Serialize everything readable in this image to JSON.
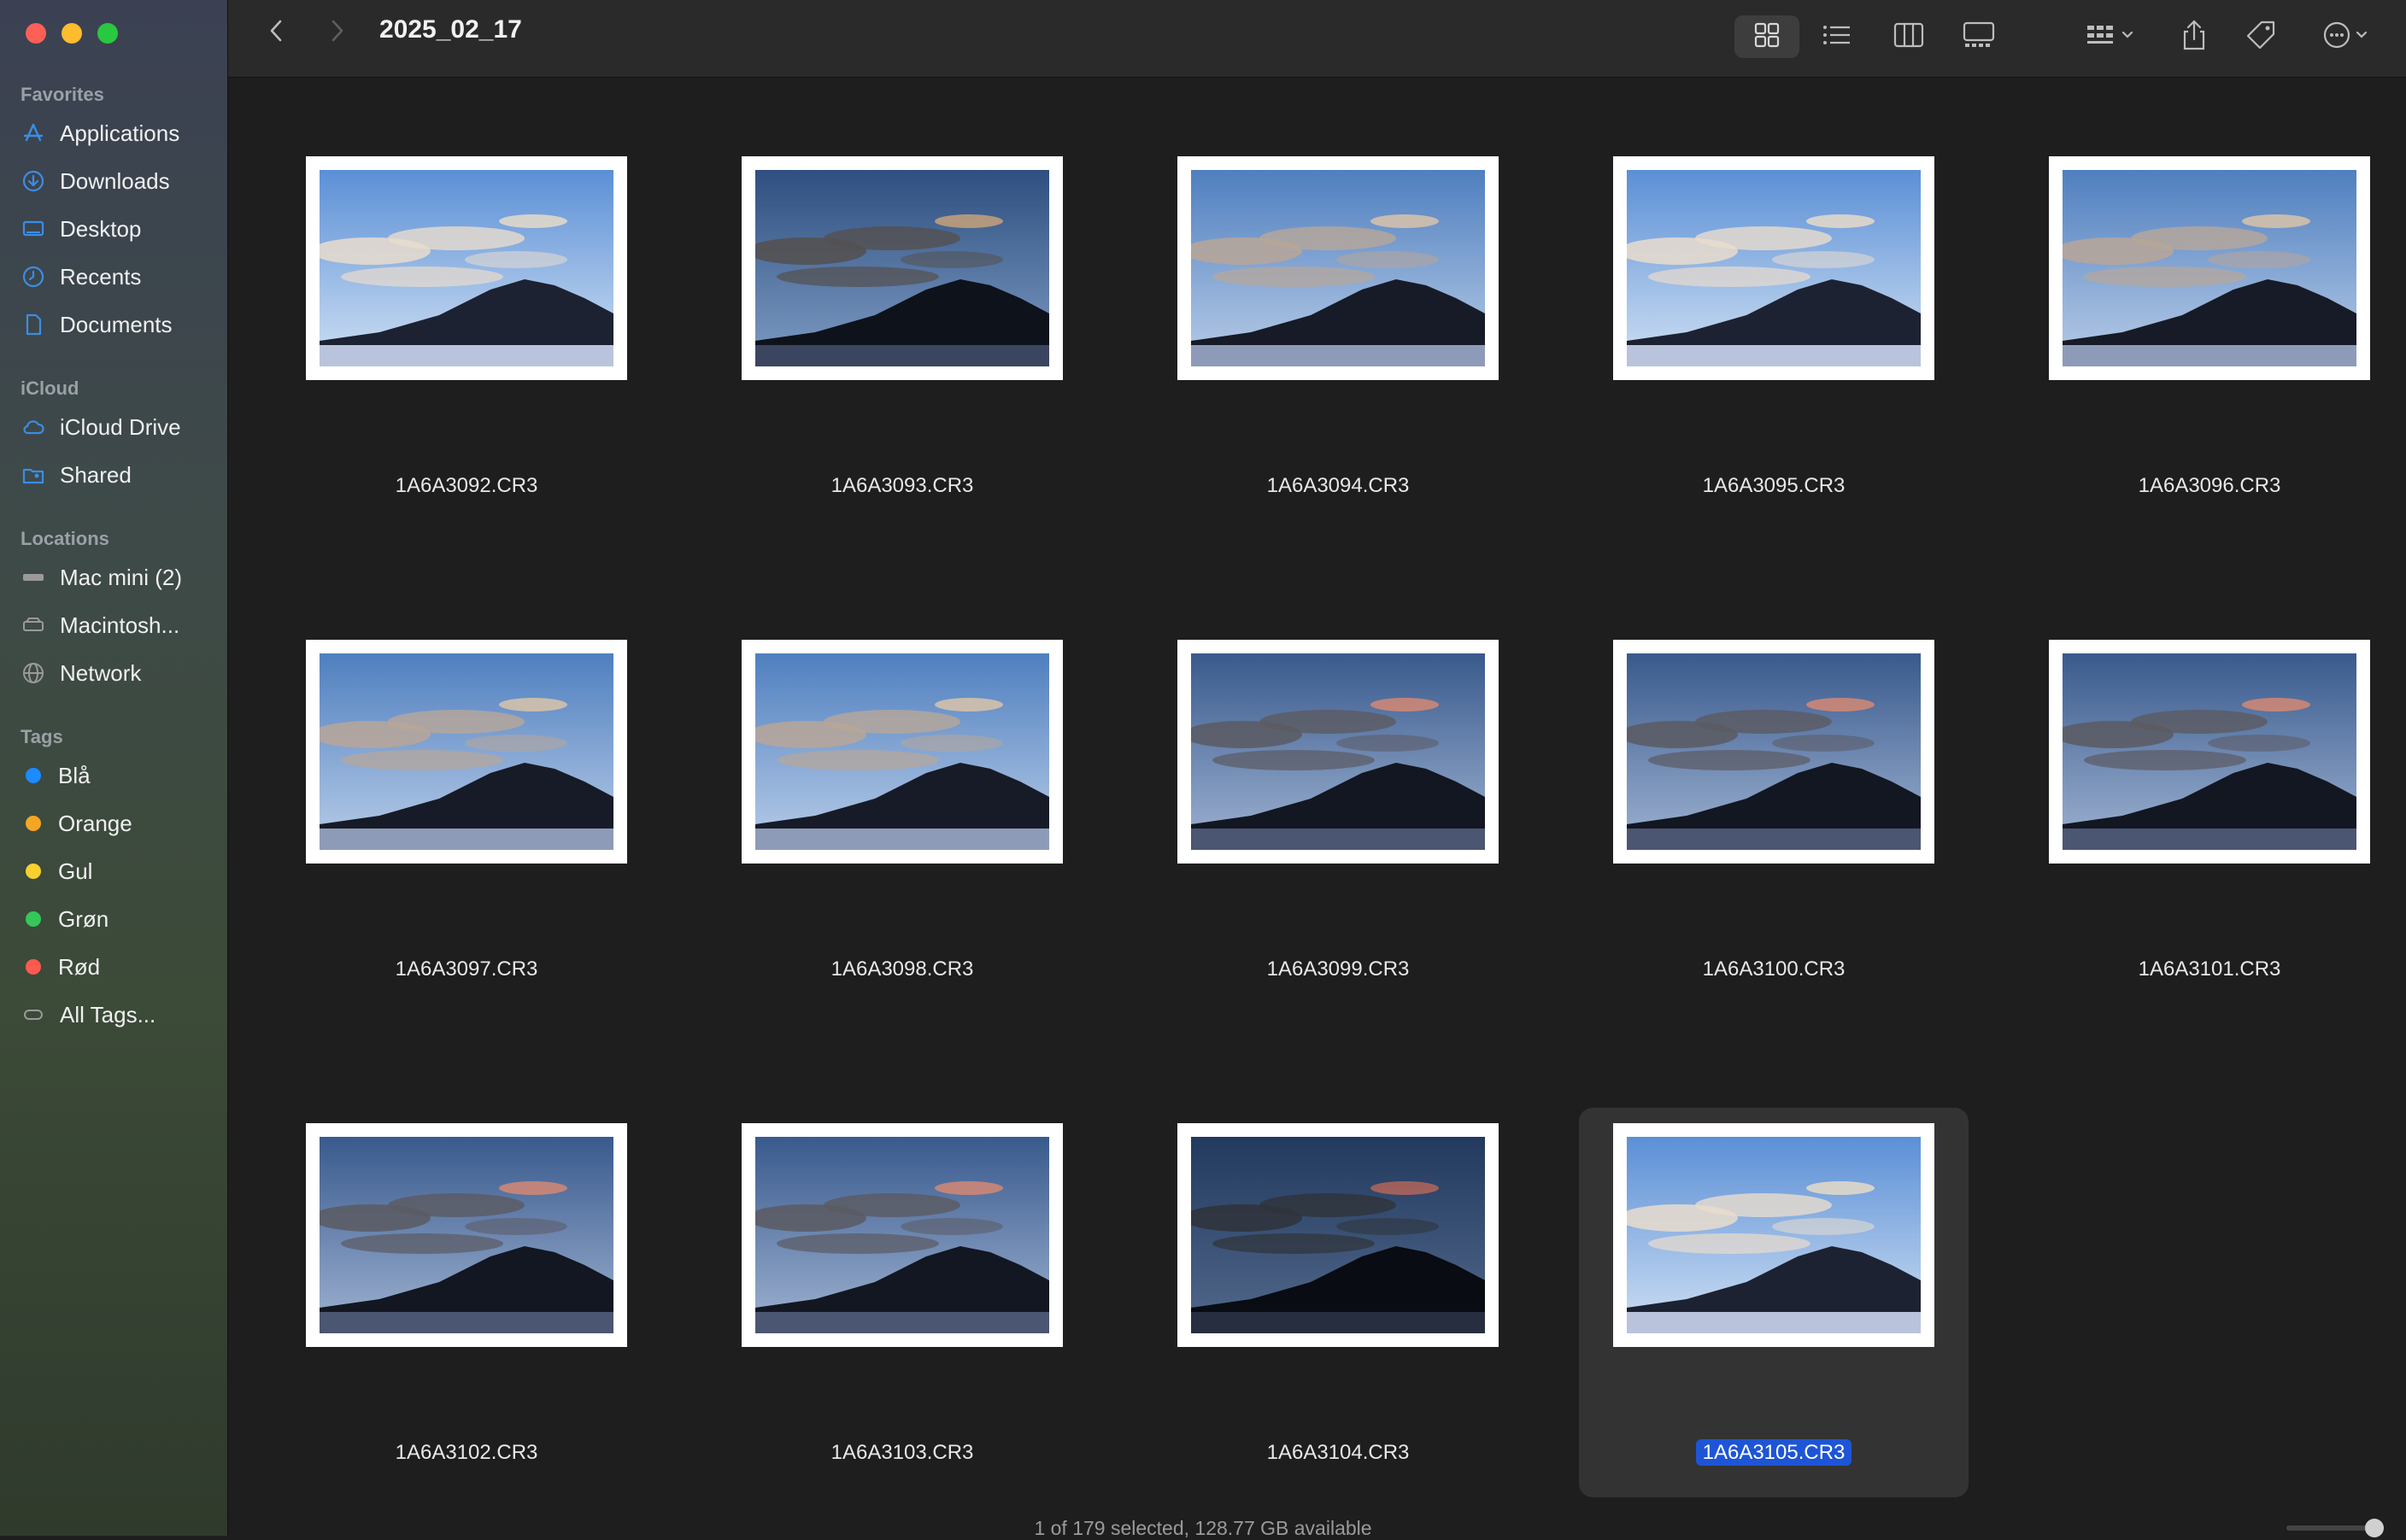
{
  "window": {
    "title": "2025_02_17"
  },
  "sidebar": {
    "favorites_label": "Favorites",
    "favorites": [
      {
        "label": "Applications",
        "icon": "applications-icon"
      },
      {
        "label": "Downloads",
        "icon": "downloads-icon"
      },
      {
        "label": "Desktop",
        "icon": "desktop-icon"
      },
      {
        "label": "Recents",
        "icon": "recents-icon"
      },
      {
        "label": "Documents",
        "icon": "documents-icon"
      }
    ],
    "icloud_label": "iCloud",
    "icloud": [
      {
        "label": "iCloud Drive",
        "icon": "icloud-icon"
      },
      {
        "label": "Shared",
        "icon": "shared-folder-icon"
      }
    ],
    "locations_label": "Locations",
    "locations": [
      {
        "label": "Mac mini (2)",
        "icon": "mac-mini-icon"
      },
      {
        "label": "Macintosh...",
        "icon": "disk-icon"
      },
      {
        "label": "Network",
        "icon": "network-icon"
      }
    ],
    "tags_label": "Tags",
    "tags": [
      {
        "label": "Blå",
        "color": "#1a8cff"
      },
      {
        "label": "Orange",
        "color": "#f5a623"
      },
      {
        "label": "Gul",
        "color": "#f8d12f"
      },
      {
        "label": "Grøn",
        "color": "#34c759"
      },
      {
        "label": "Rød",
        "color": "#ff5a4f"
      },
      {
        "label": "All Tags...",
        "icon": "all-tags-icon"
      }
    ]
  },
  "toolbar": {
    "icons": [
      "back-icon",
      "forward-icon",
      "icon-view-icon",
      "list-view-icon",
      "column-view-icon",
      "gallery-view-icon",
      "group-by-icon",
      "share-icon",
      "tag-icon",
      "more-options-icon"
    ],
    "active_view": "icon-view"
  },
  "files": [
    {
      "name": "1A6A3092.CR3",
      "tone": "bright"
    },
    {
      "name": "1A6A3093.CR3",
      "tone": "dark"
    },
    {
      "name": "1A6A3094.CR3",
      "tone": "normal"
    },
    {
      "name": "1A6A3095.CR3",
      "tone": "bright"
    },
    {
      "name": "1A6A3096.CR3",
      "tone": "normal"
    },
    {
      "name": "1A6A3097.CR3",
      "tone": "normal"
    },
    {
      "name": "1A6A3098.CR3",
      "tone": "normal"
    },
    {
      "name": "1A6A3099.CR3",
      "tone": "dusk"
    },
    {
      "name": "1A6A3100.CR3",
      "tone": "dusk"
    },
    {
      "name": "1A6A3101.CR3",
      "tone": "dusk"
    },
    {
      "name": "1A6A3102.CR3",
      "tone": "dusk"
    },
    {
      "name": "1A6A3103.CR3",
      "tone": "dusk"
    },
    {
      "name": "1A6A3104.CR3",
      "tone": "night"
    },
    {
      "name": "1A6A3105.CR3",
      "tone": "bright",
      "selected": true
    }
  ],
  "status": {
    "text": "1 of 179 selected, 128.77 GB available"
  },
  "colors": {
    "selection": "#1d55d6",
    "sidebar_accent": "#1a8cff"
  }
}
